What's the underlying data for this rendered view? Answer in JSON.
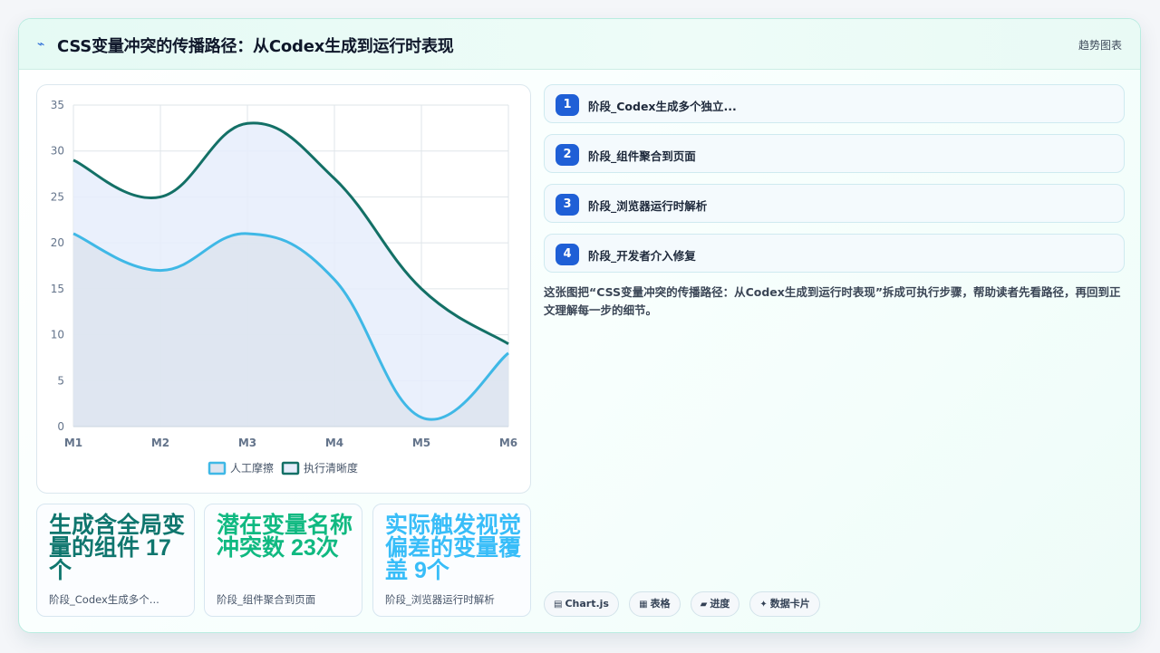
{
  "header": {
    "icon": "bolt-icon",
    "title": "CSS变量冲突的传播路径：从Codex生成到运行时表现",
    "tag": "趋势图表"
  },
  "chart_data": {
    "type": "line",
    "categories": [
      "M1",
      "M2",
      "M3",
      "M4",
      "M5",
      "M6"
    ],
    "ylim": [
      0,
      35
    ],
    "yticks": [
      0,
      5,
      10,
      15,
      20,
      25,
      30,
      35
    ],
    "grid": true,
    "legend_position": "bottom",
    "series": [
      {
        "name": "人工摩擦",
        "values": [
          21,
          17,
          21,
          16,
          1,
          8
        ],
        "color": "#3fb8e6",
        "fill": "#dde4ef"
      },
      {
        "name": "执行清晰度",
        "values": [
          29,
          25,
          33,
          27,
          15,
          9
        ],
        "color": "#137066",
        "fill": "#e6edfb"
      }
    ]
  },
  "stats": [
    {
      "value": "生成含全局变量的组件 17个",
      "label": "阶段_Codex生成多个...",
      "color": "#0f766e"
    },
    {
      "value": "潜在变量名称冲突数 23次",
      "label": "阶段_组件聚合到页面",
      "color": "#10b981"
    },
    {
      "value": "实际触发视觉偏差的变量覆盖 9个",
      "label": "阶段_浏览器运行时解析",
      "color": "#38bdf8"
    }
  ],
  "steps": [
    {
      "num": "1",
      "text": "阶段_Codex生成多个独立..."
    },
    {
      "num": "2",
      "text": "阶段_组件聚合到页面"
    },
    {
      "num": "3",
      "text": "阶段_浏览器运行时解析"
    },
    {
      "num": "4",
      "text": "阶段_开发者介入修复"
    }
  ],
  "description": "这张图把“CSS变量冲突的传播路径：从Codex生成到运行时表现”拆成可执行步骤，帮助读者先看路径，再回到正文理解每一步的细节。",
  "pills": [
    {
      "icon": "chart-icon",
      "glyph": "▤",
      "label": "Chart.js"
    },
    {
      "icon": "table-icon",
      "glyph": "▦",
      "label": "表格"
    },
    {
      "icon": "progress-icon",
      "glyph": "▰",
      "label": "进度"
    },
    {
      "icon": "sparkle-icon",
      "glyph": "✦",
      "label": "数据卡片"
    }
  ]
}
